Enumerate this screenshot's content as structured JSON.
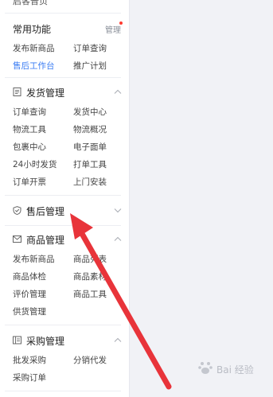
{
  "sidebar": {
    "top_cut_text": "启客普页",
    "common": {
      "title": "常用功能",
      "manage_label": "管理",
      "items": [
        "发布新商品",
        "订单查询",
        "售后工作台",
        "推广计划"
      ],
      "active_item": "售后工作台"
    },
    "shipping": {
      "title": "发货管理",
      "icon": "document-icon",
      "expanded": true,
      "items": [
        "订单查询",
        "发货中心",
        "物流工具",
        "物流概况",
        "包裹中心",
        "电子面单",
        "24小时发货",
        "打单工具",
        "订单开票",
        "上门安装"
      ]
    },
    "after_sales": {
      "title": "售后管理",
      "icon": "shield-check-icon",
      "expanded": false
    },
    "product": {
      "title": "商品管理",
      "icon": "envelope-icon",
      "expanded": true,
      "items": [
        "发布新商品",
        "商品列表",
        "商品体检",
        "商品素材",
        "评价管理",
        "商品工具",
        "供货管理"
      ]
    },
    "purchase": {
      "title": "采购管理",
      "icon": "card-icon",
      "expanded": true,
      "items": [
        "批发采购",
        "分销代发",
        "采购订单"
      ]
    }
  },
  "annotation": {
    "type": "arrow",
    "color": "#e8343a",
    "points_to": "售后管理"
  },
  "watermark": {
    "text": "Bai 经验"
  },
  "colors": {
    "accent": "#3a7cf3",
    "dot": "#ff3b30",
    "background": "#f1f2f6"
  }
}
